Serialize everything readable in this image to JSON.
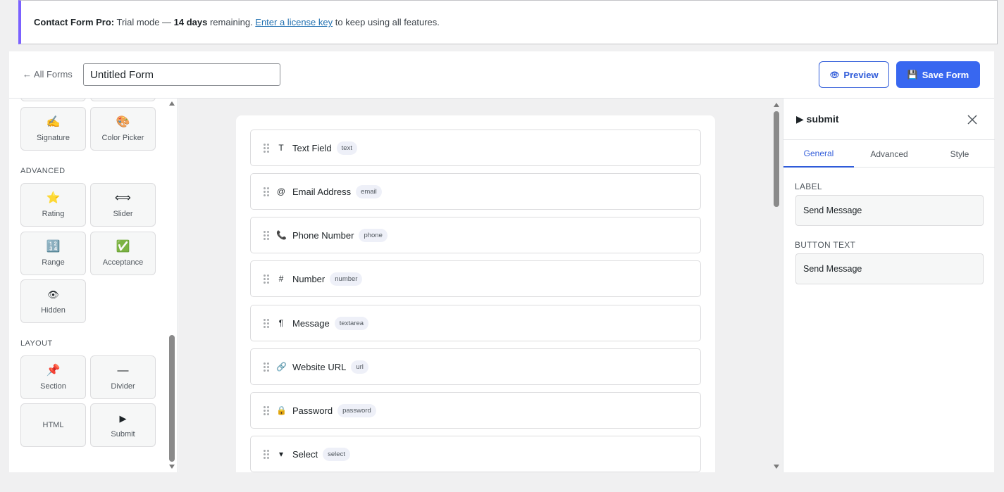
{
  "notice": {
    "product": "Contact Form Pro:",
    "text1": " Trial mode — ",
    "days": "14 days",
    "text2": " remaining. ",
    "link": "Enter a license key",
    "text3": " to keep using all features.",
    "accent": "#7b61ff"
  },
  "header": {
    "back_label": "← All Forms",
    "form_title": "Untitled Form",
    "preview_icon": "👁",
    "preview_label": "Preview",
    "save_icon": "💾",
    "save_label": "Save Form"
  },
  "palette": {
    "top_tiles": [
      {
        "icon": "✍️",
        "label": "Signature"
      },
      {
        "icon": "🎨",
        "label": "Color Picker"
      }
    ],
    "advanced": {
      "title": "ADVANCED",
      "tiles": [
        {
          "icon": "⭐",
          "label": "Rating"
        },
        {
          "icon": "⟺",
          "label": "Slider"
        },
        {
          "icon": "🔢",
          "label": "Range"
        },
        {
          "icon": "✅",
          "label": "Acceptance"
        },
        {
          "icon": "👁",
          "label": "Hidden"
        }
      ]
    },
    "layout": {
      "title": "LAYOUT",
      "tiles": [
        {
          "icon": "📌",
          "label": "Section"
        },
        {
          "icon": "—",
          "label": "Divider"
        },
        {
          "icon": "",
          "label": "HTML"
        },
        {
          "icon": "▶",
          "label": "Submit"
        }
      ]
    }
  },
  "fields": [
    {
      "icon": "T",
      "label": "Text Field",
      "type": "text"
    },
    {
      "icon": "@",
      "label": "Email Address",
      "type": "email"
    },
    {
      "icon": "📞",
      "label": "Phone Number",
      "type": "phone"
    },
    {
      "icon": "#",
      "label": "Number",
      "type": "number"
    },
    {
      "icon": "¶",
      "label": "Message",
      "type": "textarea"
    },
    {
      "icon": "🔗",
      "label": "Website URL",
      "type": "url"
    },
    {
      "icon": "🔒",
      "label": "Password",
      "type": "password"
    },
    {
      "icon": "▾",
      "label": "Select",
      "type": "select"
    }
  ],
  "settings": {
    "title": "▶ submit",
    "tabs": [
      "General",
      "Advanced",
      "Style"
    ],
    "active_tab": "General",
    "label_title": "LABEL",
    "label_value": "Send Message",
    "button_text_title": "BUTTON TEXT",
    "button_text_value": "Send Message"
  },
  "colors": {
    "primary": "#3867f0",
    "accent_blue": "#2f5bd9"
  }
}
